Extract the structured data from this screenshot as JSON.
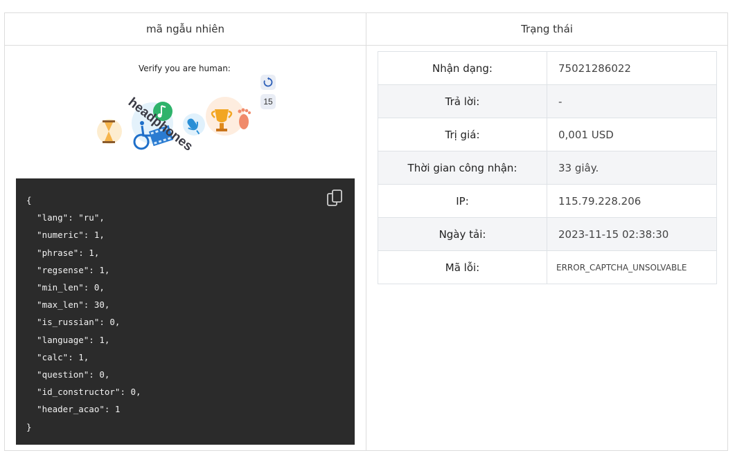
{
  "header": {
    "left": "mã ngẫu nhiên",
    "right": "Trạng thái"
  },
  "captcha": {
    "title": "Verify you are human:",
    "counter": "15",
    "distractor_word": "headphones",
    "icons": [
      "hourglass-icon",
      "music-note-icon",
      "wheelchair-icon",
      "film-strip-icon",
      "microphone-icon",
      "trophy-icon",
      "footprint-icon",
      "refresh-icon"
    ]
  },
  "code": {
    "lines": [
      "{",
      "  \"lang\": \"ru\",",
      "  \"numeric\": 1,",
      "  \"phrase\": 1,",
      "  \"regsense\": 1,",
      "  \"min_len\": 0,",
      "  \"max_len\": 30,",
      "  \"is_russian\": 0,",
      "  \"language\": 1,",
      "  \"calc\": 1,",
      "  \"question\": 0,",
      "  \"id_constructor\": 0,",
      "  \"header_acao\": 1",
      "}"
    ]
  },
  "status": {
    "rows": [
      {
        "key": "Nhận dạng:",
        "value": "75021286022"
      },
      {
        "key": "Trả lời:",
        "value": "-"
      },
      {
        "key": "Trị giá:",
        "value": "0,001 USD"
      },
      {
        "key": "Thời gian công nhận:",
        "value": "33 giây."
      },
      {
        "key": "IP:",
        "value": "115.79.228.206"
      },
      {
        "key": "Ngày tải:",
        "value": "2023-11-15 02:38:30"
      },
      {
        "key": "Mã lỗi:",
        "value": "ERROR_CAPTCHA_UNSOLVABLE"
      }
    ]
  },
  "colors": {
    "code_bg": "#2b2b2b",
    "border": "#dee2e6",
    "stripe": "#f4f5f7",
    "accent": "#2d5fb8"
  }
}
